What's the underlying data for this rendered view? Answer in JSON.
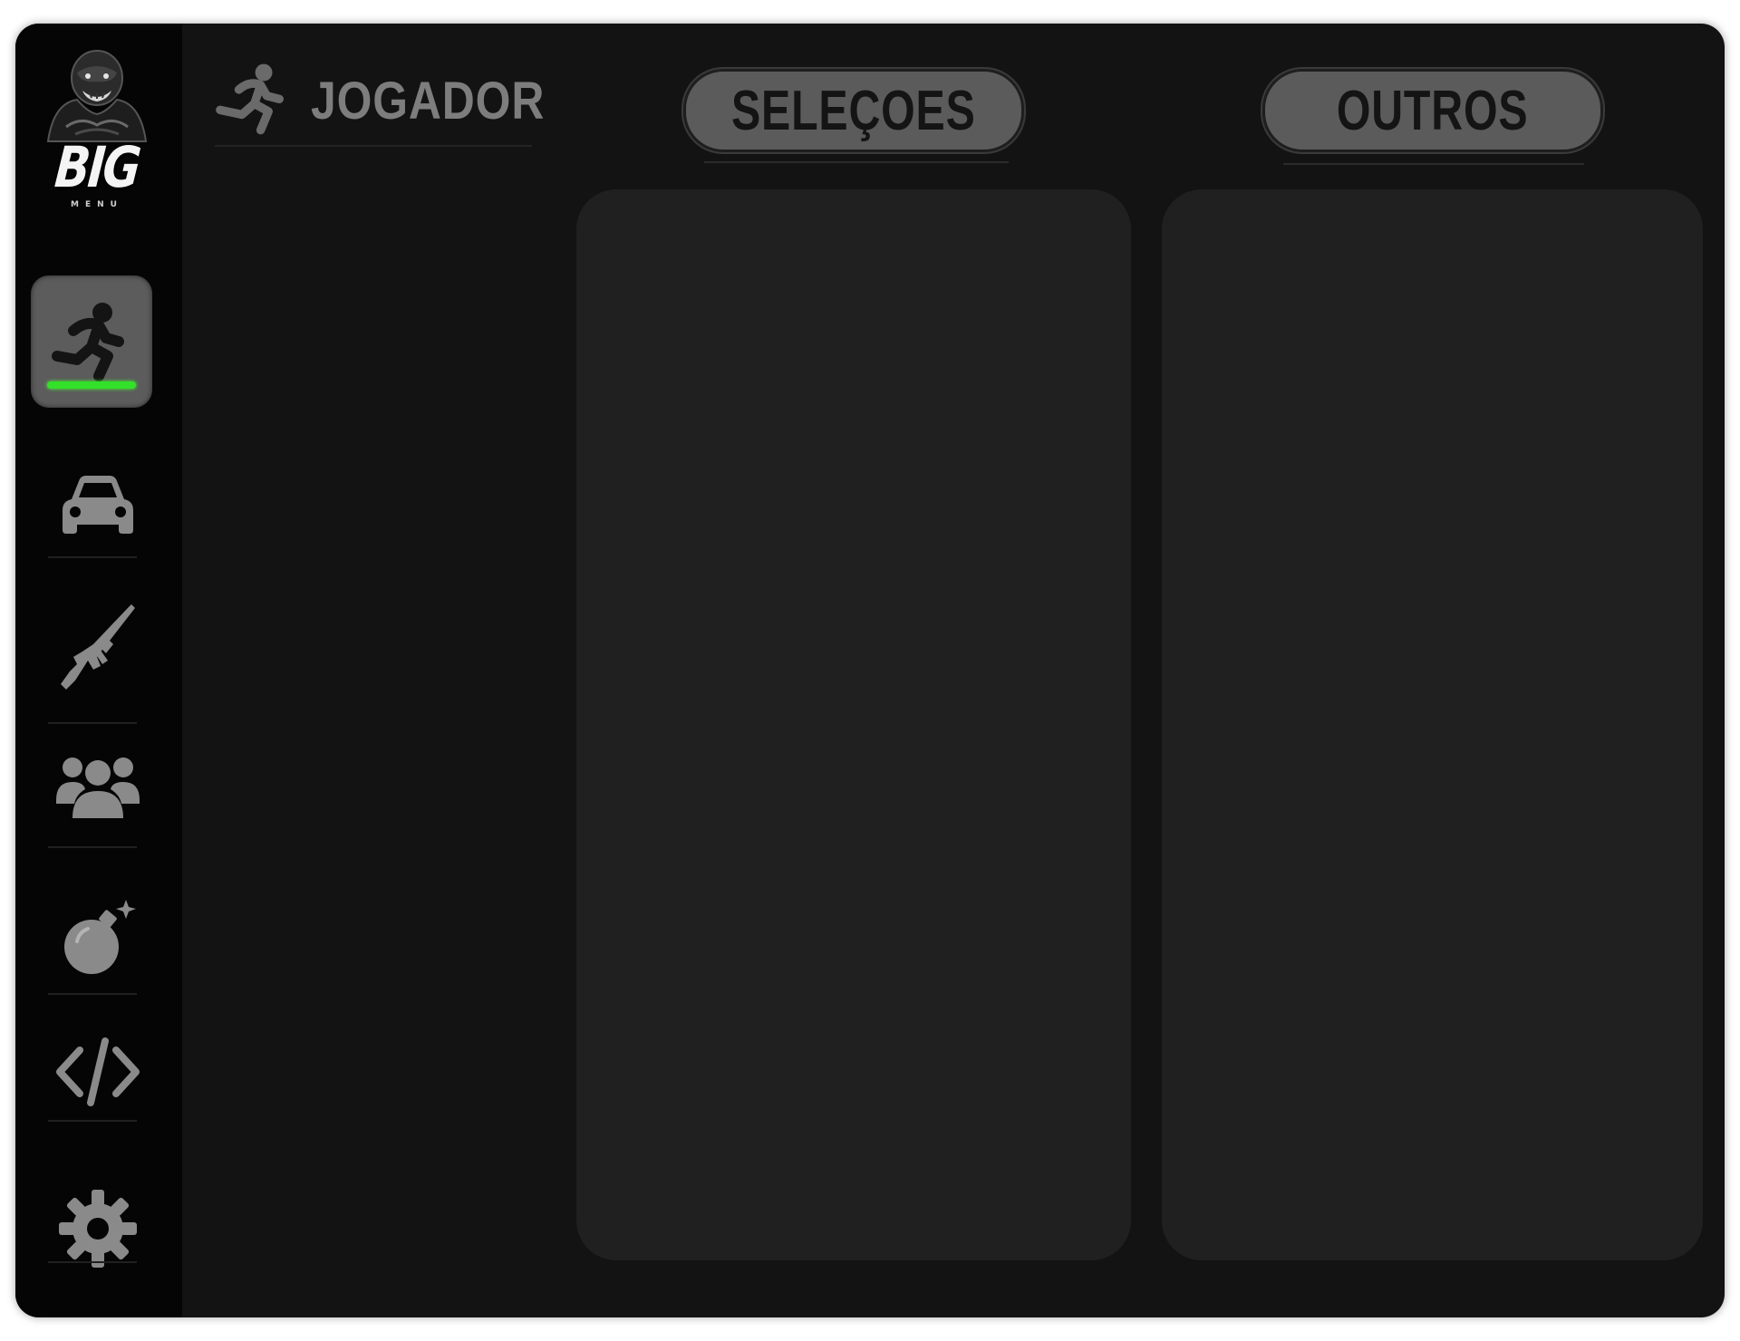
{
  "app": {
    "logo_text": "BIG",
    "logo_subtext": "MENU"
  },
  "sidebar": {
    "items": [
      {
        "name": "jogador",
        "icon": "running-person-icon",
        "active": true
      },
      {
        "name": "veiculos",
        "icon": "car-icon",
        "active": false
      },
      {
        "name": "armas",
        "icon": "rifle-icon",
        "active": false
      },
      {
        "name": "jogadores-online",
        "icon": "group-icon",
        "active": false
      },
      {
        "name": "destruicao",
        "icon": "bomb-icon",
        "active": false
      },
      {
        "name": "scripts",
        "icon": "code-icon",
        "active": false
      },
      {
        "name": "configuracoes",
        "icon": "gear-icon",
        "active": false
      }
    ],
    "active_indicator_color": "#33e02a"
  },
  "header": {
    "title": "JOGADOR",
    "icon": "running-person-icon"
  },
  "sections": [
    {
      "label": "SELEÇOES"
    },
    {
      "label": "OUTROS"
    }
  ],
  "colors": {
    "window_bg": "#131313",
    "sidebar_bg": "#050505",
    "panel_bg": "#202020",
    "pill_bg": "#5b5b5b",
    "accent": "#33e02a"
  }
}
